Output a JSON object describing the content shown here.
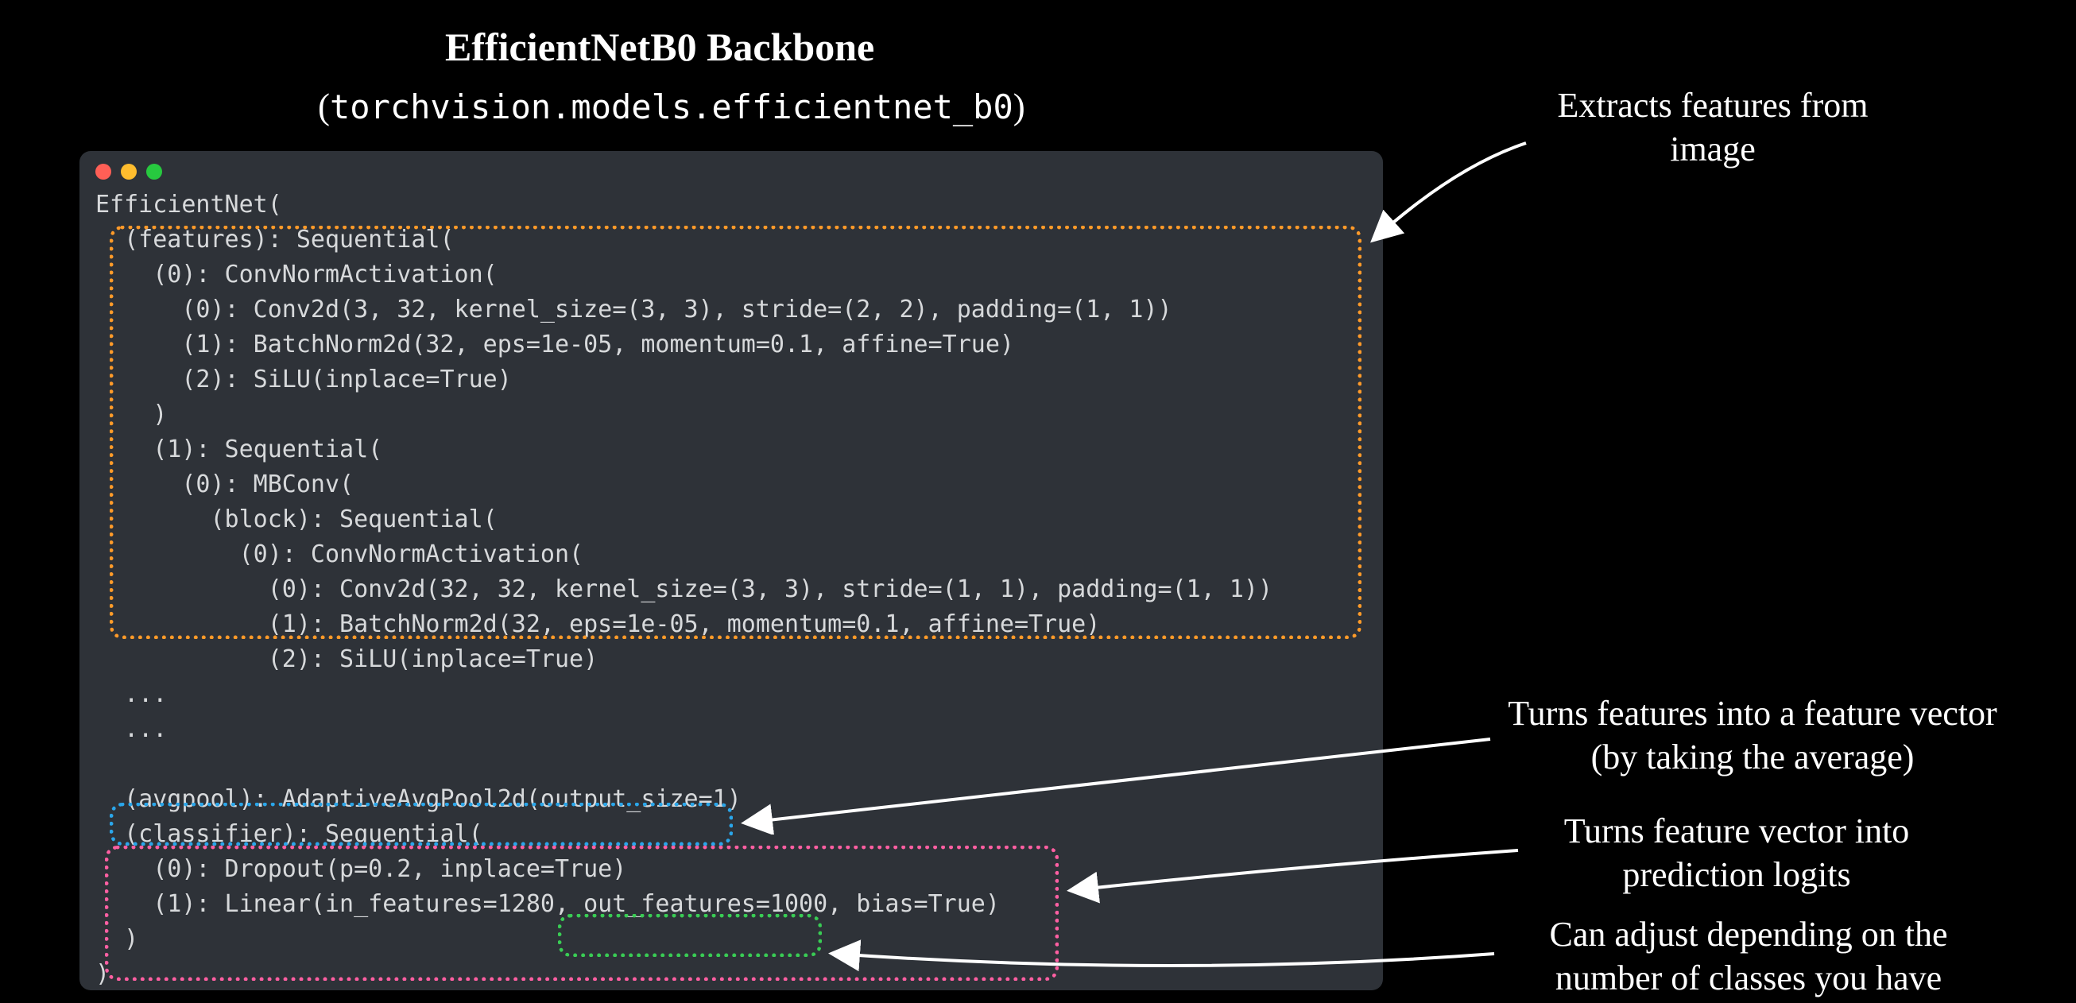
{
  "title": "EfficientNetB0 Backbone",
  "subtitle_prefix": "(",
  "subtitle_mono": "torchvision.models.efficientnet_b0",
  "subtitle_suffix": ")",
  "code": "EfficientNet(\n  (features): Sequential(\n    (0): ConvNormActivation(\n      (0): Conv2d(3, 32, kernel_size=(3, 3), stride=(2, 2), padding=(1, 1))\n      (1): BatchNorm2d(32, eps=1e-05, momentum=0.1, affine=True)\n      (2): SiLU(inplace=True)\n    )\n    (1): Sequential(\n      (0): MBConv(\n        (block): Sequential(\n          (0): ConvNormActivation(\n            (0): Conv2d(32, 32, kernel_size=(3, 3), stride=(1, 1), padding=(1, 1))\n            (1): BatchNorm2d(32, eps=1e-05, momentum=0.1, affine=True)\n            (2): SiLU(inplace=True)\n  ...\n  ...\n\n  (avgpool): AdaptiveAvgPool2d(output_size=1)\n  (classifier): Sequential(\n    (0): Dropout(p=0.2, inplace=True)\n    (1): Linear(in_features=1280, out_features=1000, bias=True)\n  )\n)",
  "annotations": {
    "features": "Extracts features from image",
    "avgpool": "Turns features into a feature vector (by taking the average)",
    "classifier": "Turns feature vector into prediction logits",
    "classes": "Can adjust depending on the number of classes you have"
  },
  "colors": {
    "orange": "#ff9a29",
    "blue": "#2aa6ea",
    "pink": "#ff5fa2",
    "green": "#39cc54",
    "bg": "#000000",
    "window": "#2e3238"
  }
}
